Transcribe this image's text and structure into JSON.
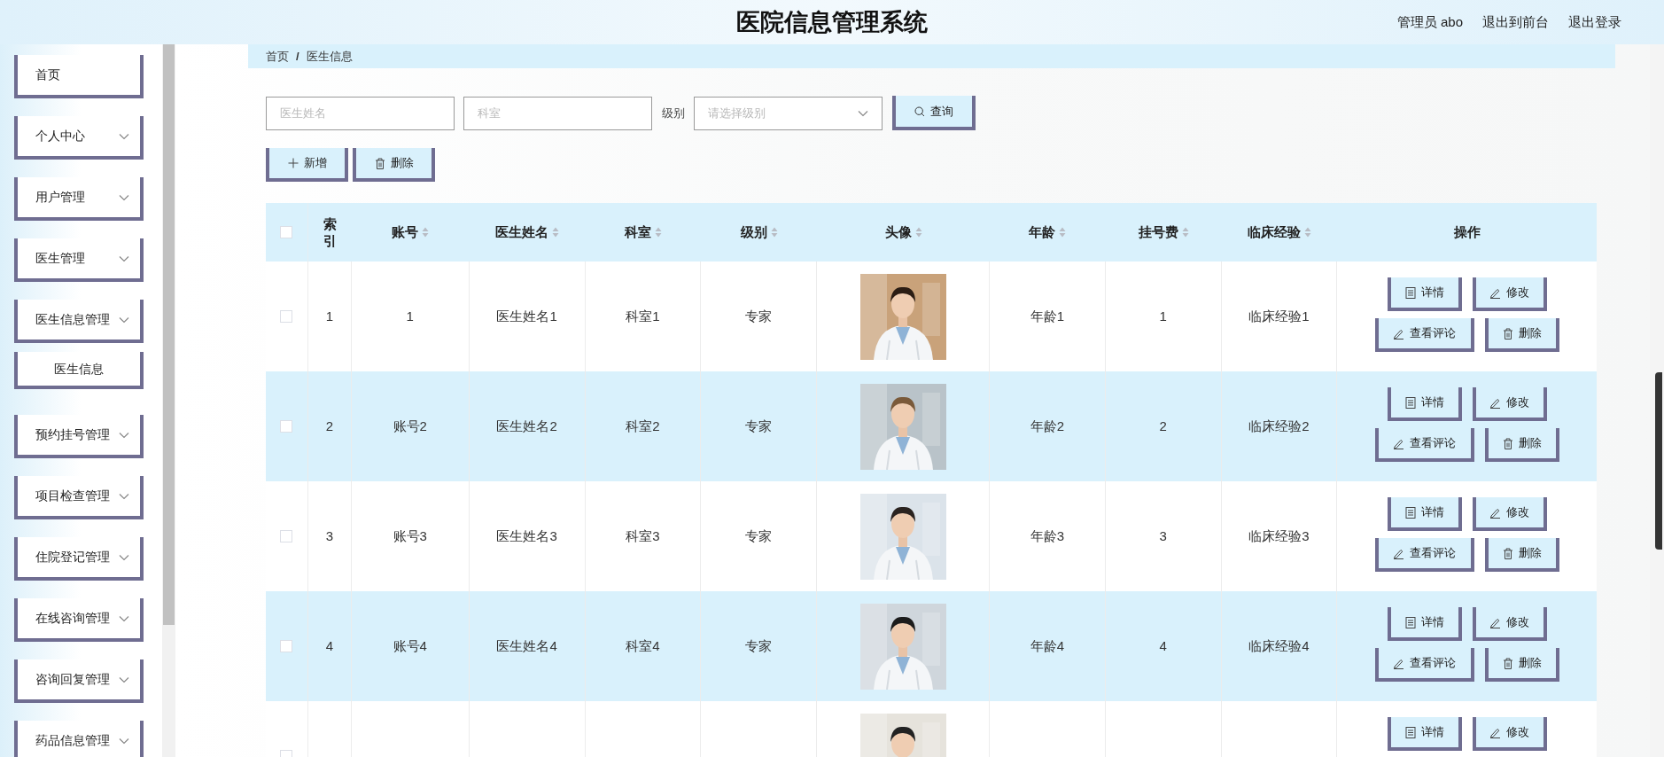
{
  "header": {
    "title": "医院信息管理系统",
    "links": [
      "管理员 abo",
      "退出到前台",
      "退出登录"
    ]
  },
  "sidebar": {
    "items": [
      {
        "label": "首页",
        "expandable": false
      },
      {
        "label": "个人中心",
        "expandable": true
      },
      {
        "label": "用户管理",
        "expandable": true
      },
      {
        "label": "医生管理",
        "expandable": true
      },
      {
        "label": "医生信息管理",
        "expandable": true,
        "children": [
          {
            "label": "医生信息"
          }
        ]
      },
      {
        "label": "预约挂号管理",
        "expandable": true
      },
      {
        "label": "项目检查管理",
        "expandable": true
      },
      {
        "label": "住院登记管理",
        "expandable": true
      },
      {
        "label": "在线咨询管理",
        "expandable": true
      },
      {
        "label": "咨询回复管理",
        "expandable": true
      },
      {
        "label": "药品信息管理",
        "expandable": true
      }
    ]
  },
  "breadcrumb": [
    "首页",
    "/",
    "医生信息"
  ],
  "search": {
    "name_placeholder": "医生姓名",
    "dept_placeholder": "科室",
    "level_label": "级别",
    "level_placeholder": "请选择级别",
    "button": "查询"
  },
  "actions": [
    {
      "kind": "add",
      "label": "新增"
    },
    {
      "kind": "delete",
      "label": "删除"
    }
  ],
  "table": {
    "columns": [
      {
        "label": "索引",
        "sortable": false
      },
      {
        "label": "账号",
        "sortable": true
      },
      {
        "label": "医生姓名",
        "sortable": true
      },
      {
        "label": "科室",
        "sortable": true
      },
      {
        "label": "级别",
        "sortable": true
      },
      {
        "label": "头像",
        "sortable": true
      },
      {
        "label": "年龄",
        "sortable": true
      },
      {
        "label": "挂号费",
        "sortable": true
      },
      {
        "label": "临床经验",
        "sortable": true
      },
      {
        "label": "操作",
        "sortable": false
      }
    ],
    "header_checked": false,
    "rows": [
      {
        "checked": false,
        "index": "1",
        "account": "1",
        "name": "医生姓名1",
        "dept": "科室1",
        "level": "专家",
        "avatar": {
          "kind": "picture"
        },
        "age": "年龄1",
        "fee": "1",
        "experience": "临床经验1",
        "actions": [
          {
            "kind": "detail",
            "label": "详情"
          },
          {
            "kind": "edit",
            "label": "修改"
          },
          {
            "kind": "comments",
            "label": "查看评论"
          },
          {
            "kind": "delete",
            "label": "删除"
          }
        ]
      },
      {
        "checked": false,
        "index": "2",
        "account": "账号2",
        "name": "医生姓名2",
        "dept": "科室2",
        "level": "专家",
        "avatar": {
          "kind": "picture"
        },
        "age": "年龄2",
        "fee": "2",
        "experience": "临床经验2",
        "actions": [
          {
            "kind": "detail",
            "label": "详情"
          },
          {
            "kind": "edit",
            "label": "修改"
          },
          {
            "kind": "comments",
            "label": "查看评论"
          },
          {
            "kind": "delete",
            "label": "删除"
          }
        ]
      },
      {
        "checked": false,
        "index": "3",
        "account": "账号3",
        "name": "医生姓名3",
        "dept": "科室3",
        "level": "专家",
        "avatar": {
          "kind": "picture"
        },
        "age": "年龄3",
        "fee": "3",
        "experience": "临床经验3",
        "actions": [
          {
            "kind": "detail",
            "label": "详情"
          },
          {
            "kind": "edit",
            "label": "修改"
          },
          {
            "kind": "comments",
            "label": "查看评论"
          },
          {
            "kind": "delete",
            "label": "删除"
          }
        ]
      },
      {
        "checked": false,
        "index": "4",
        "account": "账号4",
        "name": "医生姓名4",
        "dept": "科室4",
        "level": "专家",
        "avatar": {
          "kind": "picture"
        },
        "age": "年龄4",
        "fee": "4",
        "experience": "临床经验4",
        "actions": [
          {
            "kind": "detail",
            "label": "详情"
          },
          {
            "kind": "edit",
            "label": "修改"
          },
          {
            "kind": "comments",
            "label": "查看评论"
          },
          {
            "kind": "delete",
            "label": "删除"
          }
        ]
      },
      {
        "checked": false,
        "avatar": {
          "kind": "picture"
        },
        "actions": [
          {
            "kind": "detail",
            "label": "详情"
          },
          {
            "kind": "edit",
            "label": "修改"
          }
        ]
      }
    ]
  }
}
